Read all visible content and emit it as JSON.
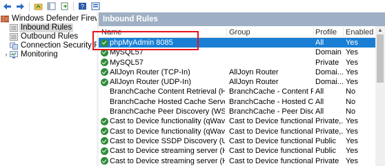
{
  "toolbar": {
    "buttons": [
      {
        "icon": "back-arrow-icon"
      },
      {
        "icon": "forward-arrow-icon"
      },
      {
        "icon": "up-folder-icon"
      },
      {
        "icon": "show-hide-tree-icon"
      },
      {
        "icon": "export-list-icon"
      },
      {
        "icon": "help-icon"
      },
      {
        "icon": "properties-icon"
      }
    ]
  },
  "tree": {
    "root": "Windows Defender Firewall with",
    "items": [
      {
        "label": "Inbound Rules",
        "selected": true,
        "icon": "inbound-rules-icon"
      },
      {
        "label": "Outbound Rules",
        "selected": false,
        "icon": "outbound-rules-icon"
      },
      {
        "label": "Connection Security Rules",
        "selected": false,
        "icon": "connection-security-icon"
      },
      {
        "label": "Monitoring",
        "selected": false,
        "icon": "monitoring-icon"
      }
    ]
  },
  "panel": {
    "title": "Inbound Rules",
    "columns": {
      "name": "Name",
      "group": "Group",
      "profile": "Profile",
      "enabled": "Enabled"
    },
    "rows": [
      {
        "name": "phpMyAdmin 8085",
        "group": "",
        "profile": "All",
        "enabled": "Yes",
        "selected": true,
        "icon": true
      },
      {
        "name": "MySQL57",
        "group": "",
        "profile": "Domain",
        "enabled": "Yes",
        "selected": false,
        "icon": true
      },
      {
        "name": "MySQL57",
        "group": "",
        "profile": "Private",
        "enabled": "Yes",
        "selected": false,
        "icon": true
      },
      {
        "name": "AllJoyn Router (TCP-In)",
        "group": "AllJoyn Router",
        "profile": "Domai...",
        "enabled": "Yes",
        "selected": false,
        "icon": true
      },
      {
        "name": "AllJoyn Router (UDP-In)",
        "group": "AllJoyn Router",
        "profile": "Domai...",
        "enabled": "Yes",
        "selected": false,
        "icon": true
      },
      {
        "name": "BranchCache Content Retrieval (HTTP-In)",
        "group": "BranchCache - Content Retri...",
        "profile": "All",
        "enabled": "No",
        "selected": false,
        "icon": false
      },
      {
        "name": "BranchCache Hosted Cache Server (HTTP-In)",
        "group": "BranchCache - Hosted Cach...",
        "profile": "All",
        "enabled": "No",
        "selected": false,
        "icon": false
      },
      {
        "name": "BranchCache Peer Discovery (WSD-In)",
        "group": "BranchCache - Peer Discovery...",
        "profile": "All",
        "enabled": "No",
        "selected": false,
        "icon": false
      },
      {
        "name": "Cast to Device functionality (qWave-TCP-In)",
        "group": "Cast to Device functionality",
        "profile": "Private,...",
        "enabled": "Yes",
        "selected": false,
        "icon": true
      },
      {
        "name": "Cast to Device functionality (qWave-UDP-...",
        "group": "Cast to Device functionality",
        "profile": "Private,...",
        "enabled": "Yes",
        "selected": false,
        "icon": true
      },
      {
        "name": "Cast to Device SSDP Discovery (UDP-In)",
        "group": "Cast to Device functionality",
        "profile": "Public",
        "enabled": "Yes",
        "selected": false,
        "icon": true
      },
      {
        "name": "Cast to Device streaming server (HTTP-Str...",
        "group": "Cast to Device functionality",
        "profile": "Public",
        "enabled": "Yes",
        "selected": false,
        "icon": true
      },
      {
        "name": "Cast to Device streaming server (HTTP-Str...",
        "group": "Cast to Device functionality",
        "profile": "Private",
        "enabled": "Yes",
        "selected": false,
        "icon": true
      }
    ]
  },
  "colors": {
    "panel_header": "#9fb0c4",
    "selection": "#1a7fd4",
    "allow_icon": "#2e8b3a",
    "callout_box": "#e8101c"
  }
}
